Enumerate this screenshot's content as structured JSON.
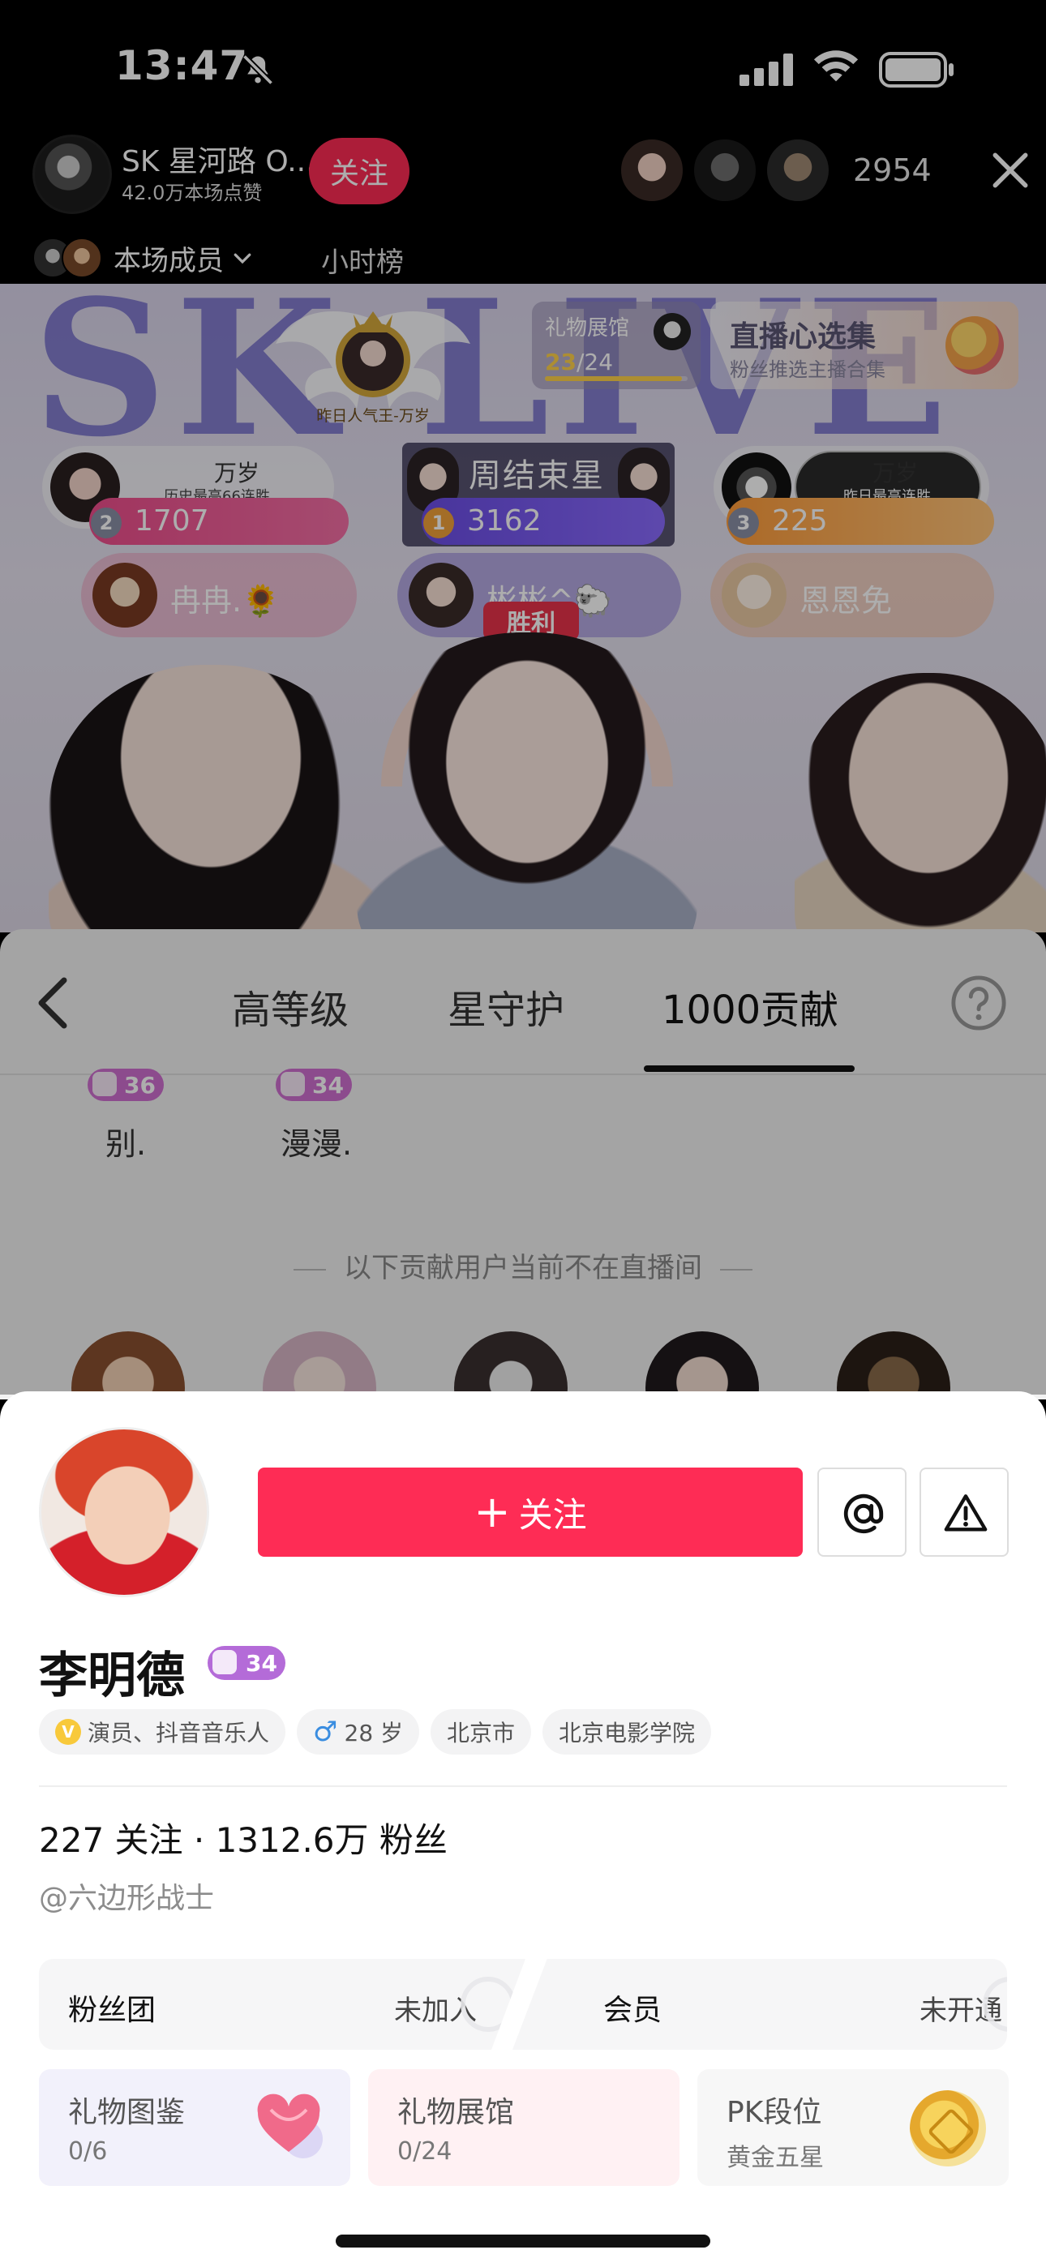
{
  "status_bar": {
    "time": "13:47"
  },
  "live_header": {
    "host_name": "SK 星河路 O...",
    "host_likes": "42.0万本场点赞",
    "follow_label": "关注",
    "viewer_count": "2954",
    "members_label": "本场成员",
    "hour_rank_label": "小时榜"
  },
  "stage": {
    "logo_text": "SK LIVE",
    "crest_caption": "昨日人气王-万岁",
    "gift_hall": {
      "label": "礼物展馆",
      "collected": "23",
      "total": "/24",
      "progress": 0.96
    },
    "picks": {
      "title": "直播心选集",
      "subtitle": "粉丝推选主播合集"
    },
    "ranks": [
      {
        "place": "2",
        "name": "万岁",
        "note": "历史最高66连胜",
        "score": "1707"
      },
      {
        "place": "1",
        "title": "周结束星",
        "score": "3162"
      },
      {
        "place": "3",
        "name": "万岁",
        "note": "昨日最高连胜",
        "score": "225"
      }
    ],
    "chips": [
      "冉冉.🌻",
      "彬彬^🐑",
      "恩恩免"
    ],
    "win_tag": "胜利"
  },
  "rank_panel": {
    "tabs": [
      "高等级",
      "星守护",
      "1000贡献"
    ],
    "active_tab": "1000贡献",
    "contributors": [
      {
        "level": "36",
        "name": "别."
      },
      {
        "level": "34",
        "name": "漫漫."
      }
    ],
    "absent_note": "以下贡献用户当前不在直播间"
  },
  "profile": {
    "follow_button": "关注",
    "name": "李明德",
    "level": "34",
    "tags": {
      "occupation": "演员、抖音音乐人",
      "age": "28 岁",
      "city": "北京市",
      "school": "北京电影学院"
    },
    "stats": "227 关注 · 1312.6万 粉丝",
    "handle": "@六边形战士",
    "fan_club": {
      "label": "粉丝团",
      "status": "未加入"
    },
    "membership": {
      "label": "会员",
      "status": "未开通"
    },
    "features": [
      {
        "title": "礼物图鉴",
        "sub": "0/6"
      },
      {
        "title": "礼物展馆",
        "sub": "0/24"
      },
      {
        "title": "PK段位",
        "sub": "黄金五星"
      }
    ]
  },
  "colors": {
    "accent": "#fe2c55",
    "level_badge": "#b46bd8"
  }
}
